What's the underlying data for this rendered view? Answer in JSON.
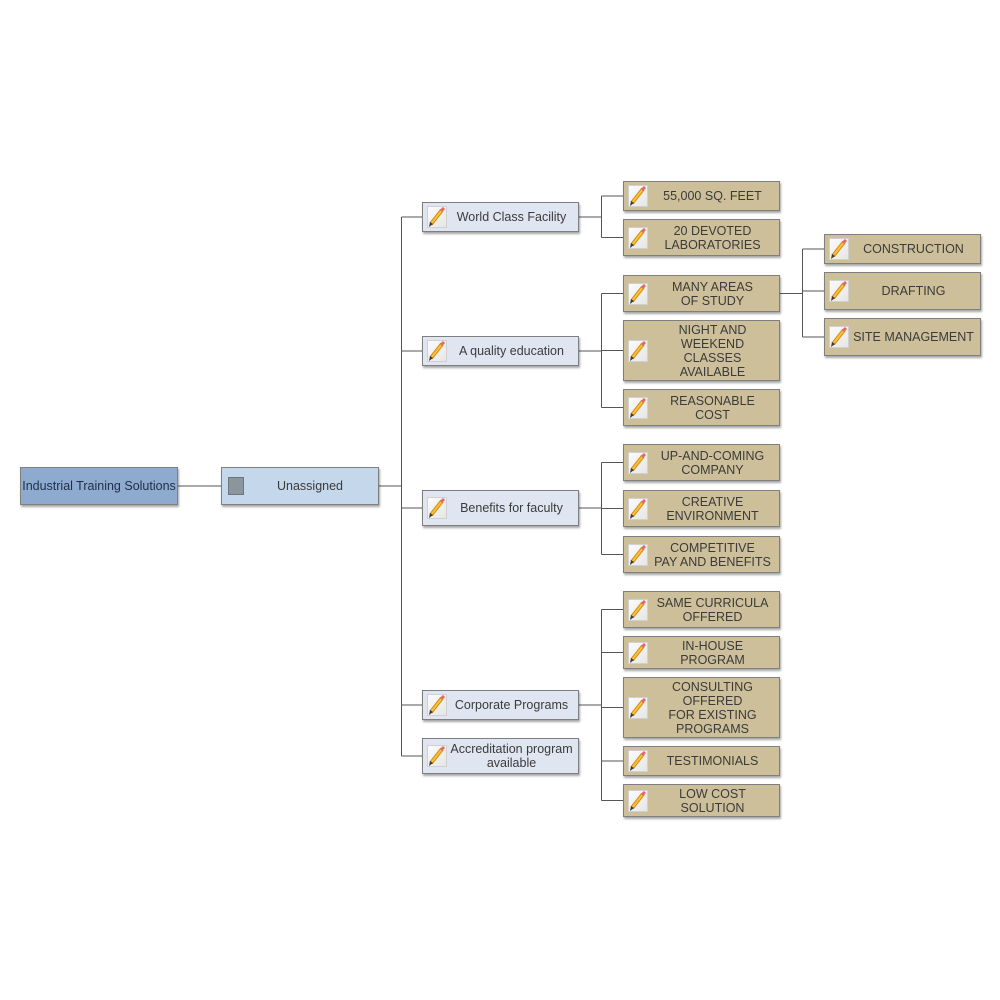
{
  "diagram": {
    "root": {
      "label": "Industrial Training Solutions"
    },
    "owner": {
      "label": "Unassigned",
      "icon": "person-icon"
    },
    "topics": [
      {
        "label": "World Class Facility",
        "icon": "pencil-icon",
        "children": [
          {
            "label": "55,000 SQ. FEET"
          },
          {
            "label": "20 DEVOTED\nLABORATORIES"
          }
        ]
      },
      {
        "label": "A quality education",
        "icon": "pencil-icon",
        "children": [
          {
            "label": "MANY AREAS\nOF STUDY",
            "children": [
              {
                "label": "CONSTRUCTION"
              },
              {
                "label": "DRAFTING"
              },
              {
                "label": "SITE MANAGEMENT"
              }
            ]
          },
          {
            "label": "NIGHT AND\nWEEKEND\nCLASSES\nAVAILABLE"
          },
          {
            "label": "REASONABLE\nCOST"
          }
        ]
      },
      {
        "label": "Benefits for faculty",
        "icon": "pencil-icon",
        "children": [
          {
            "label": "UP-AND-COMING\nCOMPANY"
          },
          {
            "label": "CREATIVE\nENVIRONMENT"
          },
          {
            "label": "COMPETITIVE\nPAY AND BENEFITS"
          }
        ]
      },
      {
        "label": "Corporate Programs",
        "icon": "pencil-icon",
        "children": [
          {
            "label": "SAME CURRICULA\nOFFERED"
          },
          {
            "label": "IN-HOUSE\nPROGRAM"
          },
          {
            "label": "CONSULTING\nOFFERED\nFOR EXISTING\nPROGRAMS"
          },
          {
            "label": "TESTIMONIALS"
          },
          {
            "label": "LOW COST\nSOLUTION"
          }
        ]
      },
      {
        "label": "Accreditation program\navailable",
        "icon": "pencil-icon",
        "children": []
      }
    ]
  },
  "colors": {
    "root_fill": "#8eaacf",
    "owner_fill": "#c5d7ea",
    "topic_fill": "#dfe6f1",
    "leaf_fill": "#cdbf99",
    "connector": "#555555"
  }
}
